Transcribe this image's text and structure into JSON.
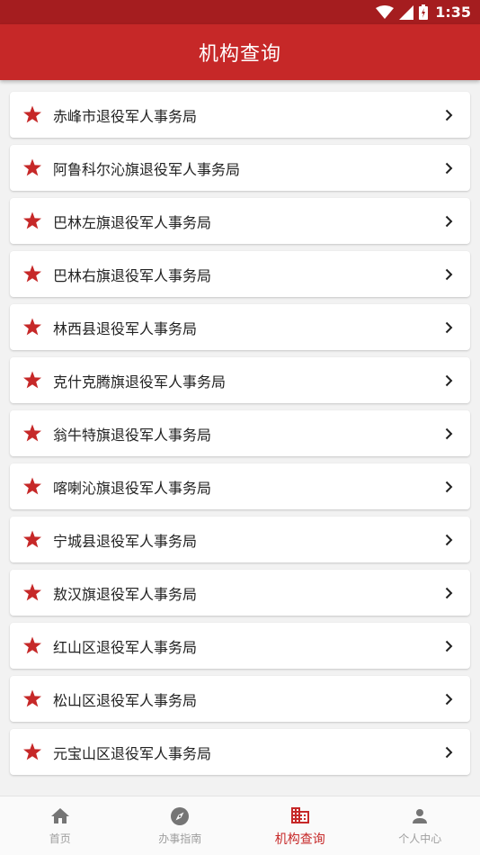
{
  "status_bar": {
    "time": "1:35",
    "icons": [
      "wifi-icon",
      "signal-icon",
      "battery-icon"
    ]
  },
  "header": {
    "title": "机构查询"
  },
  "list": {
    "items": [
      {
        "label": "赤峰市退役军人事务局"
      },
      {
        "label": "阿鲁科尔沁旗退役军人事务局"
      },
      {
        "label": "巴林左旗退役军人事务局"
      },
      {
        "label": "巴林右旗退役军人事务局"
      },
      {
        "label": "林西县退役军人事务局"
      },
      {
        "label": "克什克腾旗退役军人事务局"
      },
      {
        "label": "翁牛特旗退役军人事务局"
      },
      {
        "label": "喀喇沁旗退役军人事务局"
      },
      {
        "label": "宁城县退役军人事务局"
      },
      {
        "label": "敖汉旗退役军人事务局"
      },
      {
        "label": "红山区退役军人事务局"
      },
      {
        "label": "松山区退役军人事务局"
      },
      {
        "label": "元宝山区退役军人事务局"
      }
    ],
    "item_icon": "star-icon",
    "trailing_icon": "chevron-right-icon"
  },
  "bottom_nav": {
    "items": [
      {
        "label": "首页",
        "icon": "home-icon",
        "active": false
      },
      {
        "label": "办事指南",
        "icon": "compass-icon",
        "active": false
      },
      {
        "label": "机构查询",
        "icon": "building-icon",
        "active": true
      },
      {
        "label": "个人中心",
        "icon": "person-icon",
        "active": false
      }
    ]
  },
  "colors": {
    "primary": "#c62828",
    "status_bar": "#a51d1f",
    "star": "#c62828",
    "inactive": "#9e9e9e",
    "background": "#f2f2f2"
  }
}
